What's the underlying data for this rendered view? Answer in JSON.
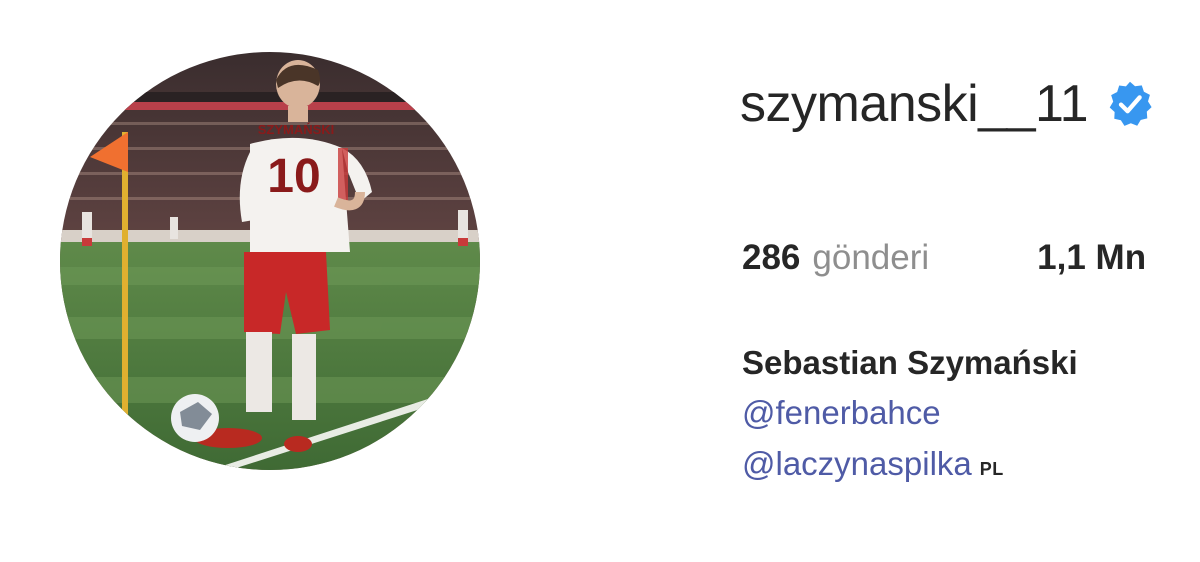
{
  "profile": {
    "username": "szymanski__11",
    "verified": true,
    "avatar": {
      "jersey_name": "SZYMAŃSKI",
      "jersey_number": "10"
    },
    "stats": [
      {
        "value": "286",
        "label": "gönderi"
      },
      {
        "value": "1,1 Mn",
        "label": ""
      }
    ],
    "full_name": "Sebastian Szymański",
    "bio_mentions": [
      {
        "text": "@fenerbahce",
        "suffix": ""
      },
      {
        "text": "@laczynaspilka",
        "suffix": "PL"
      }
    ]
  },
  "colors": {
    "verified_blue": "#3897f0",
    "link_blue": "#4f5ba6",
    "secondary_text": "#8e8e8e",
    "primary_text": "#262626"
  }
}
